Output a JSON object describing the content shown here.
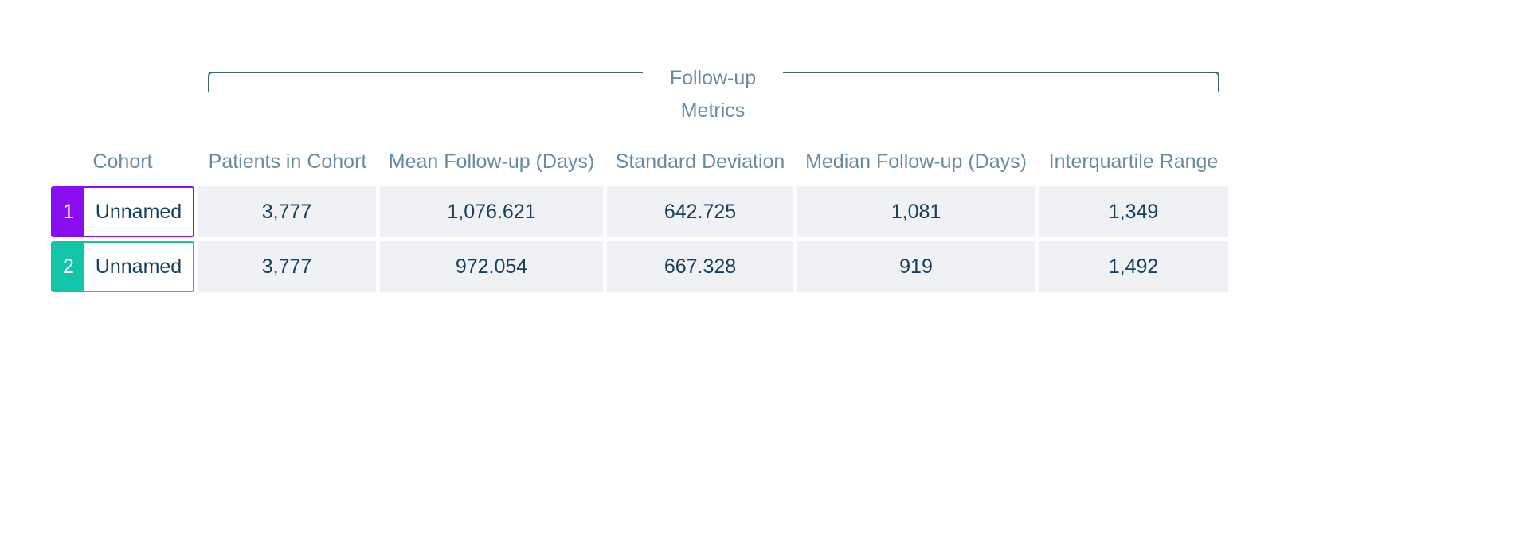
{
  "table": {
    "group_header": "Follow-up Metrics",
    "headers": [
      "Cohort",
      "Patients in Cohort",
      "Mean Follow-up (Days)",
      "Standard Deviation",
      "Median Follow-up (Days)",
      "Interquartile Range"
    ],
    "rows": [
      {
        "index": "1",
        "name": "Unnamed",
        "color": "#8a0ff0",
        "patients": "3,777",
        "mean": "1,076.621",
        "std": "642.725",
        "median": "1,081",
        "iqr": "1,349"
      },
      {
        "index": "2",
        "name": "Unnamed",
        "color": "#12c5a8",
        "patients": "3,777",
        "mean": "972.054",
        "std": "667.328",
        "median": "919",
        "iqr": "1,492"
      }
    ]
  },
  "colors": {
    "header_text": "#6a8aa1",
    "cell_text": "#16405b",
    "cell_background": "#eff1f5",
    "bracket": "#3b6584"
  }
}
